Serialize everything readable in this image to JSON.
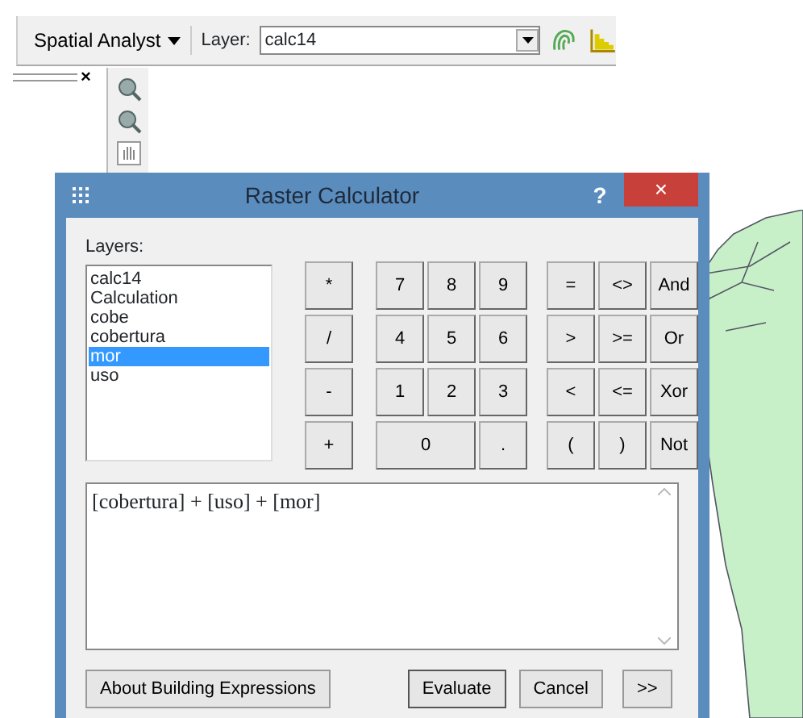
{
  "toolbar": {
    "menu": "Spatial Analyst",
    "layer_label": "Layer:",
    "layer_value": "calc14"
  },
  "dock": {
    "close": "×"
  },
  "dialog": {
    "title": "Raster Calculator",
    "help": "?",
    "close": "×",
    "layers_label": "Layers:",
    "layers": [
      {
        "label": "calc14",
        "selected": false
      },
      {
        "label": "Calculation",
        "selected": false
      },
      {
        "label": "cobe",
        "selected": false
      },
      {
        "label": "cobertura",
        "selected": false
      },
      {
        "label": "mor",
        "selected": true
      },
      {
        "label": "uso",
        "selected": false
      }
    ],
    "keypad": [
      [
        "*",
        "7",
        "8",
        "9",
        "=",
        "<>",
        "And"
      ],
      [
        "/",
        "4",
        "5",
        "6",
        ">",
        ">=",
        "Or"
      ],
      [
        "-",
        "1",
        "2",
        "3",
        "<",
        "<=",
        "Xor"
      ],
      [
        "+",
        "0",
        ".",
        "(",
        ")",
        "Not"
      ]
    ],
    "expression": "[cobertura] + [uso] + [mor]",
    "buttons": [
      {
        "label": "About Building Expressions",
        "kind": "help"
      },
      {
        "label": "Evaluate",
        "kind": "default"
      },
      {
        "label": "Cancel",
        "kind": "plain"
      },
      {
        "label": ">>",
        "kind": "plain"
      }
    ]
  }
}
